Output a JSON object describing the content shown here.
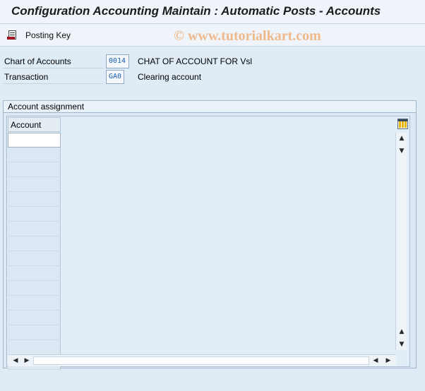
{
  "window": {
    "title": "Configuration Accounting Maintain : Automatic Posts - Accounts"
  },
  "toolbar": {
    "posting_key_label": "Posting Key",
    "posting_key_icon": "posting-key-icon"
  },
  "watermark": "© www.tutorialkart.com",
  "fields": {
    "chart_of_accounts": {
      "label": "Chart of Accounts",
      "value": "0014",
      "description": "CHAT OF ACCOUNT FOR Vsl"
    },
    "transaction": {
      "label": "Transaction",
      "value": "GA0",
      "description": "Clearing account"
    }
  },
  "account_assignment": {
    "group_title": "Account assignment",
    "columns": [
      "Account"
    ],
    "rows": [
      "",
      "",
      "",
      "",
      "",
      "",
      "",
      "",
      "",
      "",
      "",
      "",
      "",
      "",
      "",
      ""
    ]
  },
  "colors": {
    "background": "#dfebf5",
    "field_value_text": "#1a5cb0",
    "watermark": "#f0b98a"
  }
}
